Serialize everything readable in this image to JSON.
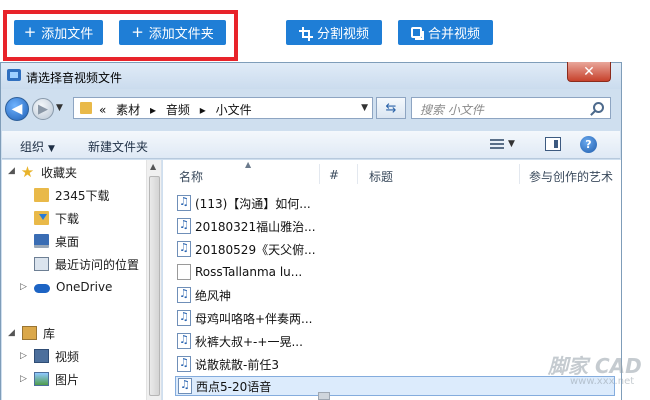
{
  "toolbar": {
    "add_file": "添加文件",
    "add_folder": "添加文件夹",
    "split_video": "分割视频",
    "merge_video": "合并视频",
    "accent_color": "#1f7ed6",
    "highlight_color": "#e8232a"
  },
  "dialog": {
    "title": "请选择音视频文件",
    "close_glyph": "✕",
    "breadcrumb": [
      "«",
      "素材",
      "▸",
      "音频",
      "▸",
      "小文件"
    ],
    "search_placeholder": "搜索 小文件",
    "commands": {
      "organize": "组织",
      "new_folder": "新建文件夹"
    },
    "nav": {
      "favorites": "收藏夹",
      "items": [
        "2345下载",
        "下载",
        "桌面",
        "最近访问的位置"
      ],
      "onedrive": "OneDrive",
      "library": "库",
      "library_items": [
        "视频",
        "图片"
      ]
    },
    "columns": {
      "name": "名称",
      "number": "#",
      "title": "标题",
      "contributing_artist": "参与创作的艺术"
    },
    "files": [
      {
        "name": "(113)【沟通】如何...",
        "type": "audio"
      },
      {
        "name": "20180321福山雅治...",
        "type": "audio"
      },
      {
        "name": "20180529《天父俯...",
        "type": "audio"
      },
      {
        "name": "RossTallanma  lu...",
        "type": "doc"
      },
      {
        "name": "绝风神",
        "type": "audio"
      },
      {
        "name": "母鸡叫咯咯+伴奏两...",
        "type": "audio"
      },
      {
        "name": "秋裤大叔+-+一晃...",
        "type": "audio"
      },
      {
        "name": "说散就散-前任3",
        "type": "audio"
      },
      {
        "name": "西点5-20语音",
        "type": "audio",
        "selected": true
      }
    ]
  },
  "watermark": {
    "main": "脚家 CAD",
    "sub": "www.xxx.net"
  }
}
